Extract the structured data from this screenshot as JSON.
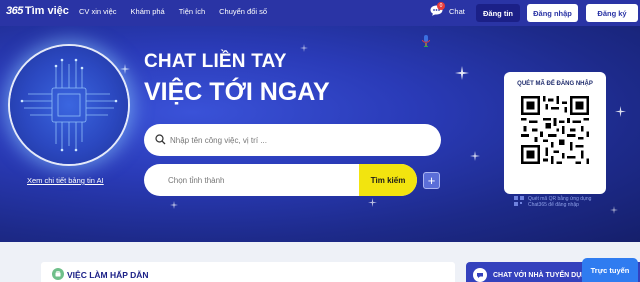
{
  "header": {
    "logo_num": "365",
    "logo_text": "Tìm việc",
    "nav": [
      "CV xin việc",
      "Khám phá",
      "Tiện ích",
      "Chuyển đổi số"
    ],
    "chat_label": "Chat",
    "chat_badge": "0",
    "register_label": "Đăng tin",
    "login_label": "Đăng nhập",
    "signup_label": "Đăng ký"
  },
  "hero": {
    "headline1": "CHAT LIỀN TAY",
    "headline2": "VIỆC TỚI NGAY",
    "search_placeholder": "Nhập tên công việc, vị trí ...",
    "location_placeholder": "Chọn tỉnh thành",
    "search_button": "Tìm kiếm",
    "plus_button": "+",
    "ai_link": "Xem chi tiết bảng tin AI",
    "qr_title": "QUÉT MÃ ĐỂ ĐĂNG NHẬP",
    "qr_caption": "Quét mã QR bằng ứng dụng Chat365 để đăng nhập"
  },
  "sections": {
    "left_title": "VIỆC LÀM HẤP DẪN",
    "right_title": "CHAT VỚI NHÀ TUYỂN DỤNG",
    "online_button": "Trực tuyến"
  },
  "colors": {
    "header_bg": "#2a34a5",
    "accent_yellow": "#f2e40f",
    "online_blue": "#2f7cf0"
  },
  "icons": {
    "chat": "chat-bubble-icon",
    "search": "search-icon",
    "mic": "mic-icon",
    "qr": "qr-code"
  }
}
